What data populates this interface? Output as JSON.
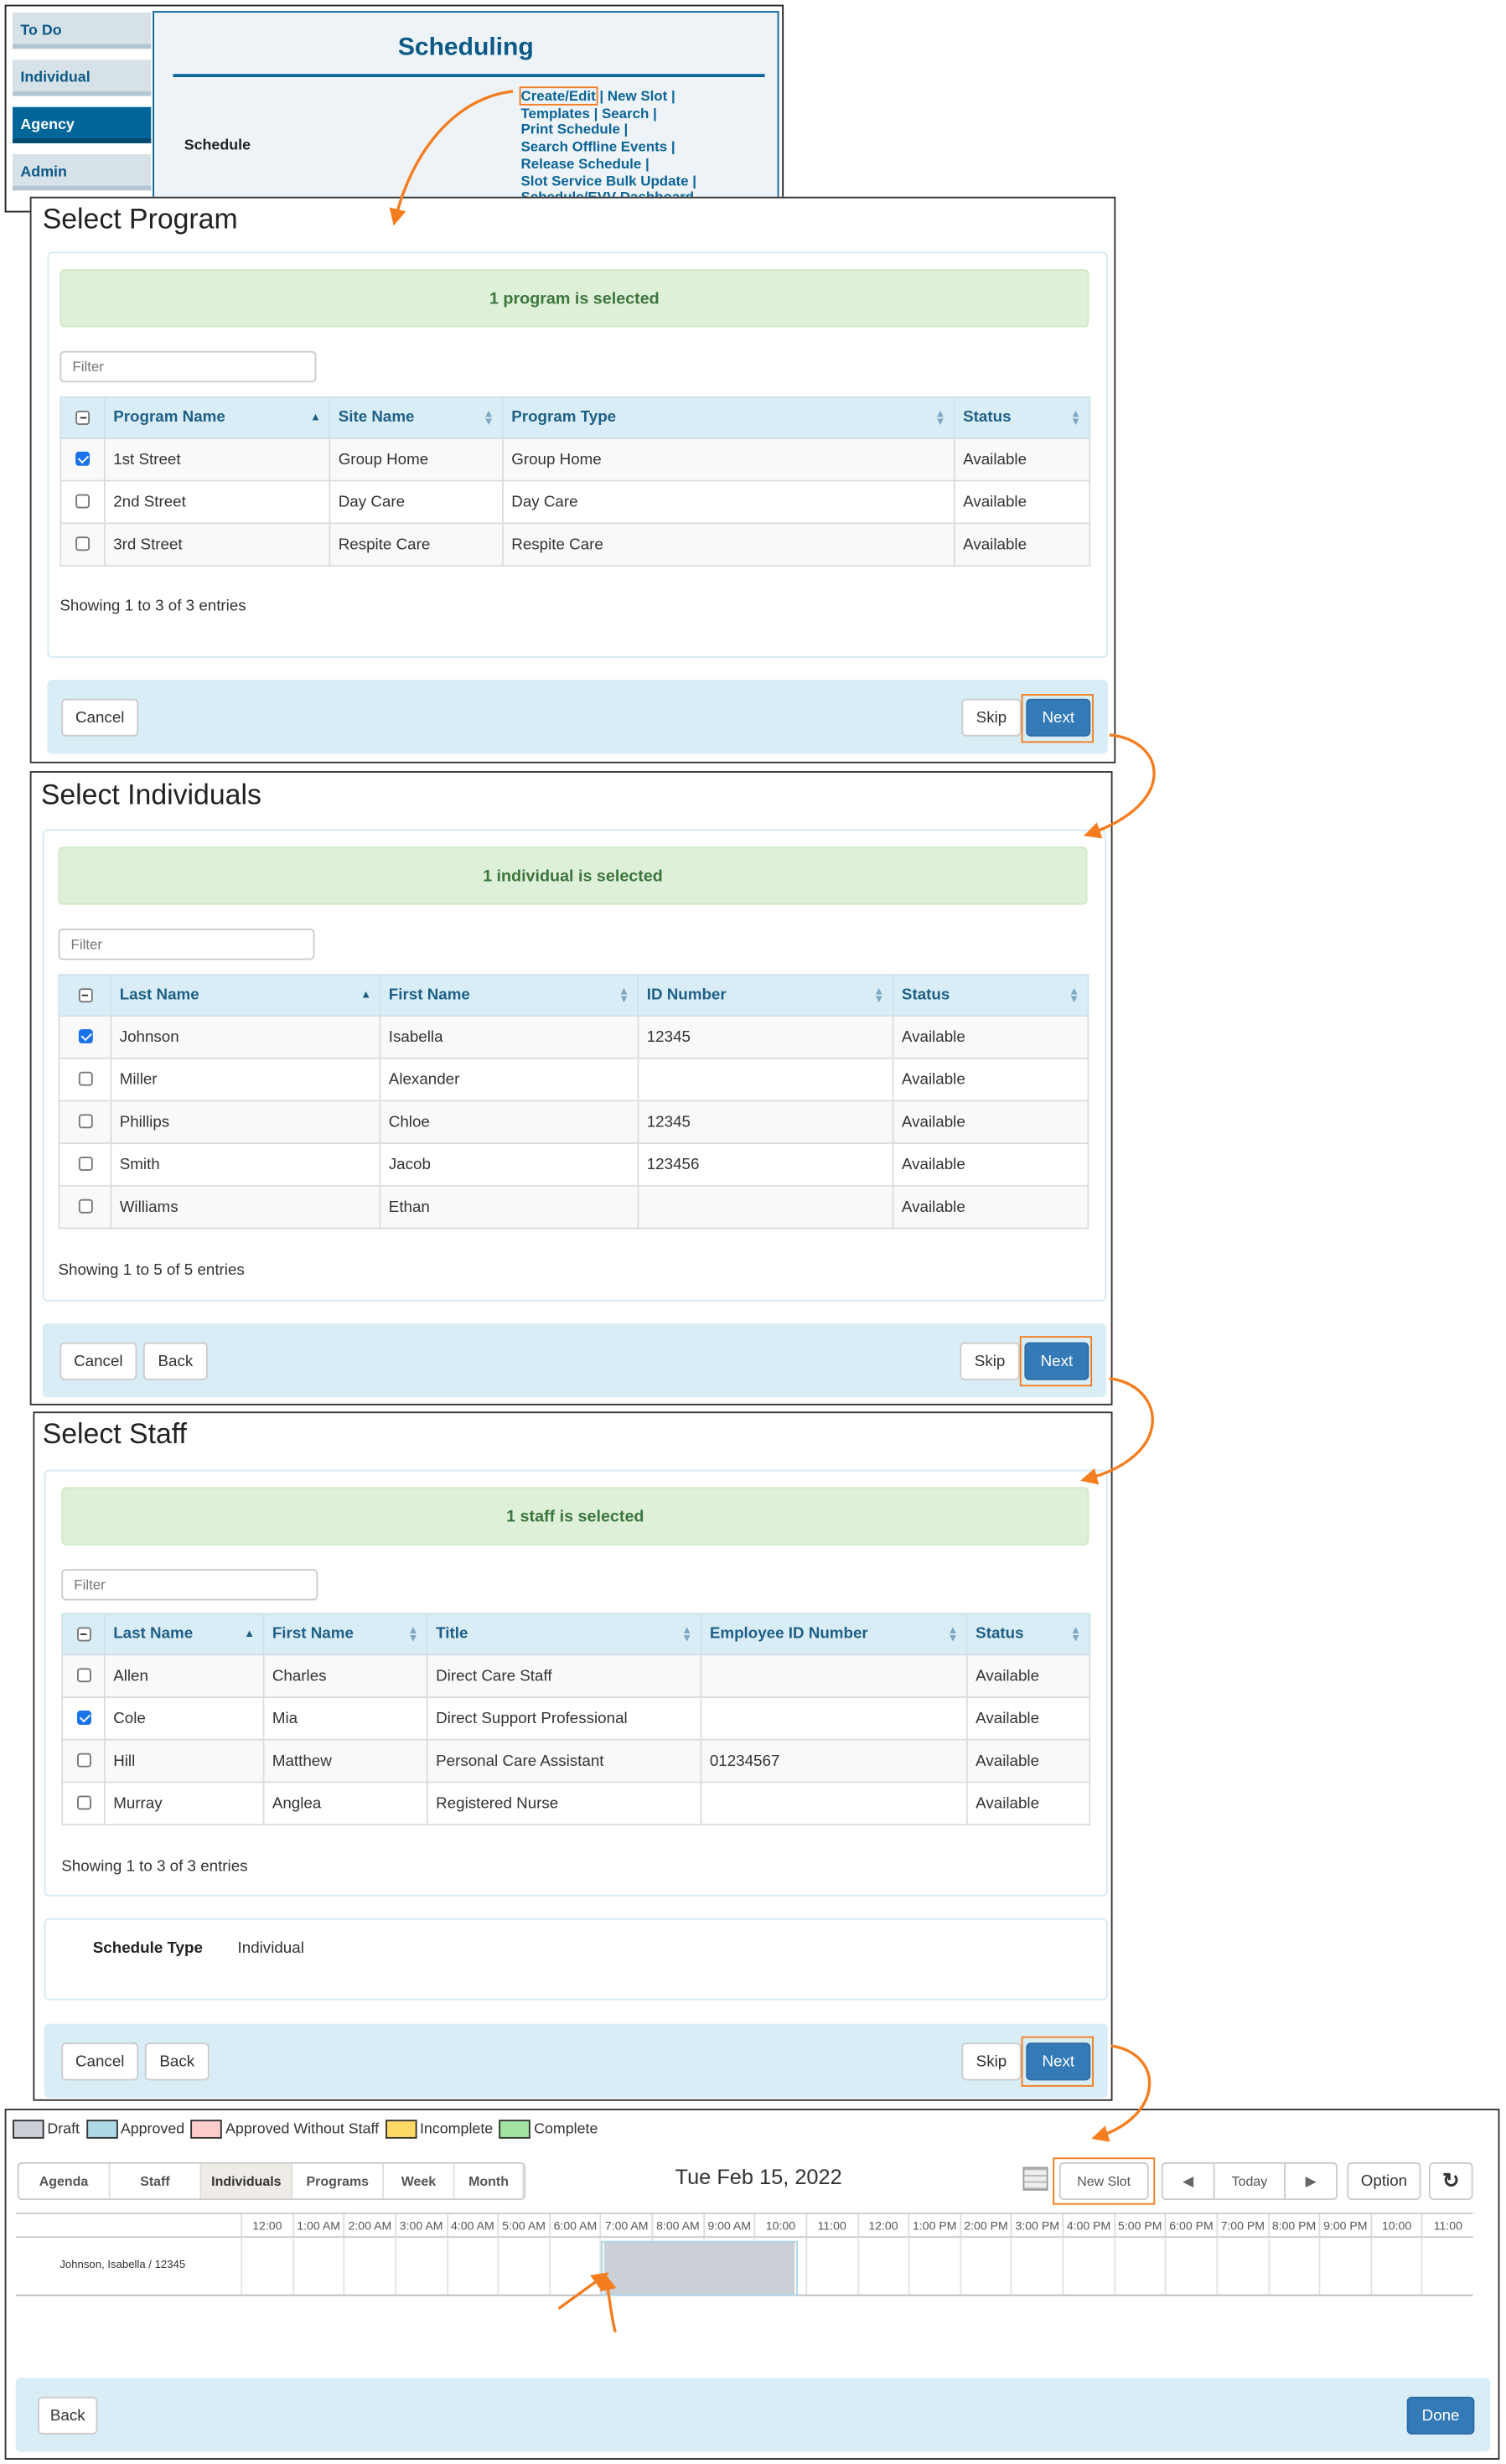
{
  "top": {
    "sidebar": [
      {
        "label": "To Do"
      },
      {
        "label": "Individual"
      },
      {
        "label": "Agency",
        "active": true
      },
      {
        "label": "Admin"
      }
    ],
    "title": "Scheduling",
    "section_label": "Schedule",
    "links": [
      "Create/Edit",
      "New Slot",
      "Templates",
      "Search",
      "Print Schedule",
      "Search Offline Events",
      "Release Schedule",
      "Slot Service Bulk Update",
      "Schedule/EVV Dashboard"
    ]
  },
  "program": {
    "title": "Select Program",
    "alert": "1 program is selected",
    "filter_placeholder": "Filter",
    "columns": [
      "Program Name",
      "Site Name",
      "Program Type",
      "Status"
    ],
    "rows": [
      {
        "checked": true,
        "cells": [
          "1st Street",
          "Group Home",
          "Group Home",
          "Available"
        ]
      },
      {
        "checked": false,
        "cells": [
          "2nd Street",
          "Day Care",
          "Day Care",
          "Available"
        ]
      },
      {
        "checked": false,
        "cells": [
          "3rd Street",
          "Respite Care",
          "Respite Care",
          "Available"
        ]
      }
    ],
    "showing": "Showing 1 to 3 of 3 entries",
    "cancel": "Cancel",
    "skip": "Skip",
    "next": "Next"
  },
  "individuals": {
    "title": "Select Individuals",
    "alert": "1 individual is selected",
    "filter_placeholder": "Filter",
    "columns": [
      "Last Name",
      "First Name",
      "ID Number",
      "Status"
    ],
    "rows": [
      {
        "checked": true,
        "cells": [
          "Johnson",
          "Isabella",
          "12345",
          "Available"
        ]
      },
      {
        "checked": false,
        "cells": [
          "Miller",
          "Alexander",
          "",
          "Available"
        ]
      },
      {
        "checked": false,
        "cells": [
          "Phillips",
          "Chloe",
          "12345",
          "Available"
        ]
      },
      {
        "checked": false,
        "cells": [
          "Smith",
          "Jacob",
          "123456",
          "Available"
        ]
      },
      {
        "checked": false,
        "cells": [
          "Williams",
          "Ethan",
          "",
          "Available"
        ]
      }
    ],
    "showing": "Showing 1 to 5 of 5 entries",
    "cancel": "Cancel",
    "back": "Back",
    "skip": "Skip",
    "next": "Next"
  },
  "staff": {
    "title": "Select Staff",
    "alert": "1 staff is selected",
    "filter_placeholder": "Filter",
    "columns": [
      "Last Name",
      "First Name",
      "Title",
      "Employee ID Number",
      "Status"
    ],
    "rows": [
      {
        "checked": false,
        "cells": [
          "Allen",
          "Charles",
          "Direct Care Staff",
          "",
          "Available"
        ]
      },
      {
        "checked": true,
        "cells": [
          "Cole",
          "Mia",
          "Direct Support Professional",
          "",
          "Available"
        ]
      },
      {
        "checked": false,
        "cells": [
          "Hill",
          "Matthew",
          "Personal Care Assistant",
          "01234567",
          "Available"
        ]
      },
      {
        "checked": false,
        "cells": [
          "Murray",
          "Anglea",
          "Registered Nurse",
          "",
          "Available"
        ]
      }
    ],
    "showing": "Showing 1 to 3 of 3 entries",
    "schedule_type_label": "Schedule Type",
    "schedule_type_value": "Individual",
    "cancel": "Cancel",
    "back": "Back",
    "skip": "Skip",
    "next": "Next"
  },
  "calendar": {
    "legend": [
      {
        "label": "Draft",
        "color": "#cbd0d6"
      },
      {
        "label": "Approved",
        "color": "#add8e6"
      },
      {
        "label": "Approved Without Staff",
        "color": "#ffcccc"
      },
      {
        "label": "Incomplete",
        "color": "#ffd966"
      },
      {
        "label": "Complete",
        "color": "#a3e4a3"
      }
    ],
    "views": [
      "Agenda",
      "Staff",
      "Individuals",
      "Programs",
      "Week",
      "Month"
    ],
    "active_view": "Individuals",
    "date": "Tue Feb 15, 2022",
    "new_slot": "New Slot",
    "today": "Today",
    "option": "Option",
    "hours": [
      "12:00",
      "1:00 AM",
      "2:00 AM",
      "3:00 AM",
      "4:00 AM",
      "5:00 AM",
      "6:00 AM",
      "7:00 AM",
      "8:00 AM",
      "9:00 AM",
      "10:00",
      "11:00",
      "12:00",
      "1:00 PM",
      "2:00 PM",
      "3:00 PM",
      "4:00 PM",
      "5:00 PM",
      "6:00 PM",
      "7:00 PM",
      "8:00 PM",
      "9:00 PM",
      "10:00",
      "11:00"
    ],
    "row_label": "Johnson, Isabella / 12345",
    "event_status": "Draft",
    "back": "Back",
    "done": "Done"
  },
  "accent": "#f47d20"
}
